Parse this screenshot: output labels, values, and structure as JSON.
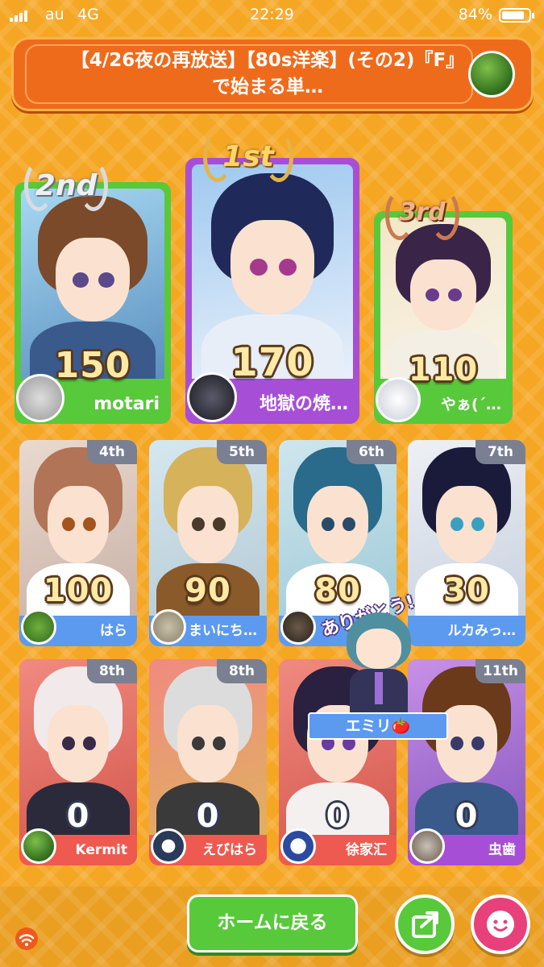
{
  "status_bar": {
    "carrier": "au",
    "network": "4G",
    "time": "22:29",
    "battery": "84%",
    "battery_level": 0.84
  },
  "banner": {
    "title": "【4/26夜の再放送】【80s洋楽】(その2)『F』で始まる単…"
  },
  "podium": [
    {
      "rank_label": "2nd",
      "score": "150",
      "name": "motari"
    },
    {
      "rank_label": "1st",
      "score": "170",
      "name": "地獄の焼…"
    },
    {
      "rank_label": "3rd",
      "score": "110",
      "name": "やぁ(´…"
    }
  ],
  "ranks": [
    {
      "rank": "4th",
      "score": "100",
      "name": "はら"
    },
    {
      "rank": "5th",
      "score": "90",
      "name": "まいにち…"
    },
    {
      "rank": "6th",
      "score": "80",
      "name": ""
    },
    {
      "rank": "7th",
      "score": "30",
      "name": "ルカみっ…"
    },
    {
      "rank": "8th",
      "score": "0",
      "name": "Kermit"
    },
    {
      "rank": "8th",
      "score": "0",
      "name": "えびはら"
    },
    {
      "rank": "",
      "score": "0",
      "name": "徐家汇"
    },
    {
      "rank": "11th",
      "score": "0",
      "name": "虫歯"
    }
  ],
  "thanks": {
    "message": "ありがとう!",
    "name": "エミリ🍅"
  },
  "buttons": {
    "home": "ホームに戻る"
  },
  "icons": {
    "share": "share-icon",
    "emote": "smile-icon",
    "wifi": "wifi-icon"
  },
  "colors": {
    "background": "#f5a623",
    "banner": "#ef6b1c",
    "green": "#58c93a",
    "purple": "#a64fd6",
    "blue": "#5c9af0",
    "red": "#ee5a4f"
  }
}
